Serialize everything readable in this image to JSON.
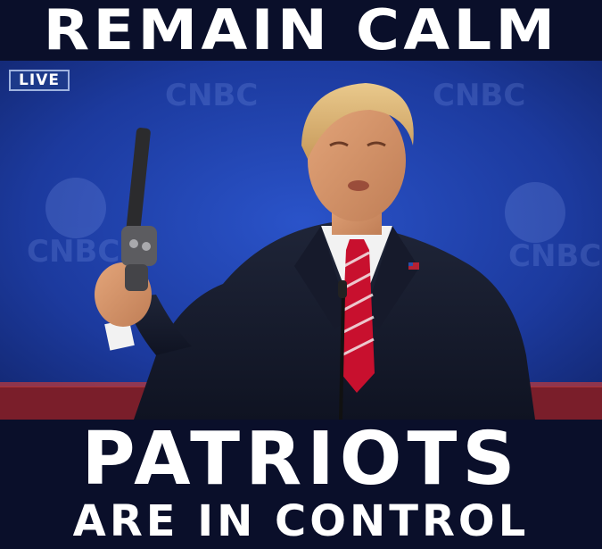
{
  "captions": {
    "top": "REMAIN CALM",
    "middle": "PATRIOTS",
    "bottom": "ARE IN CONTROL"
  },
  "broadcast": {
    "live_badge": "LIVE",
    "logo_text": "CNBC"
  },
  "colors": {
    "banner_background": "#0a0f2a",
    "studio_blue": "#1e3fa8",
    "caption_text": "#ffffff"
  }
}
